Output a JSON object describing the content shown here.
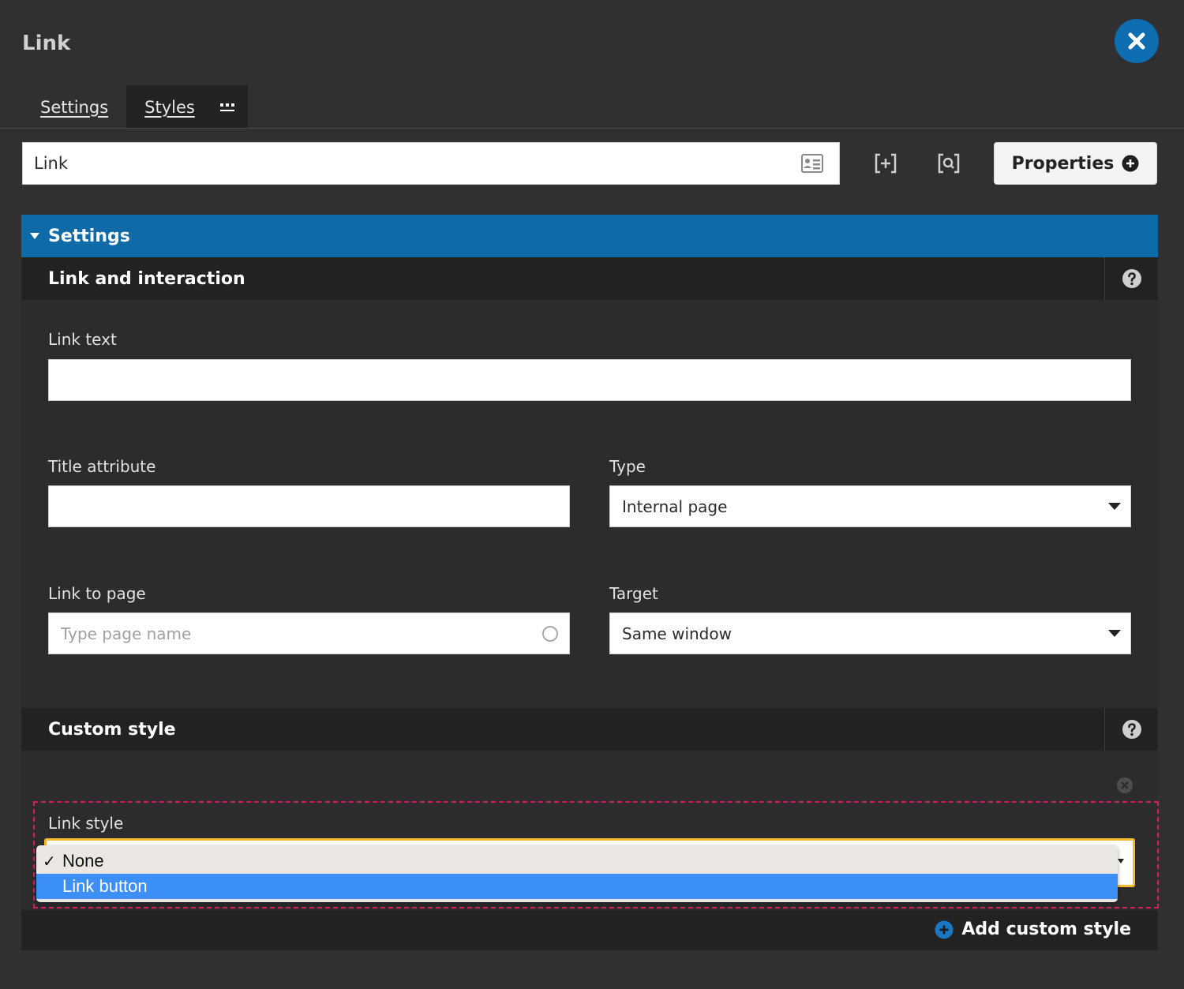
{
  "dialog": {
    "title": "Link"
  },
  "tabs": [
    {
      "label": "Settings",
      "active": true
    },
    {
      "label": "Styles",
      "active": false
    }
  ],
  "toolbar": {
    "name_value": "Link",
    "properties_label": "Properties"
  },
  "section": {
    "title": "Settings"
  },
  "link_panel": {
    "title": "Link and interaction",
    "link_text": {
      "label": "Link text",
      "value": ""
    },
    "title_attribute": {
      "label": "Title attribute",
      "value": ""
    },
    "type": {
      "label": "Type",
      "value": "Internal page"
    },
    "link_to_page": {
      "label": "Link to page",
      "placeholder": "Type page name"
    },
    "target": {
      "label": "Target",
      "value": "Same window"
    }
  },
  "custom_style_panel": {
    "title": "Custom style",
    "link_style": {
      "label": "Link style",
      "options": [
        {
          "label": "None",
          "selected": true,
          "highlighted": false
        },
        {
          "label": "Link button",
          "selected": false,
          "highlighted": true
        }
      ]
    },
    "add_label": "Add custom style"
  },
  "colors": {
    "background": "#303030",
    "accent_blue": "#0f6aa8",
    "focus_yellow": "#f5b82e",
    "highlight_blue": "#3b8ff6",
    "dashed_outline": "#d81b6a"
  }
}
